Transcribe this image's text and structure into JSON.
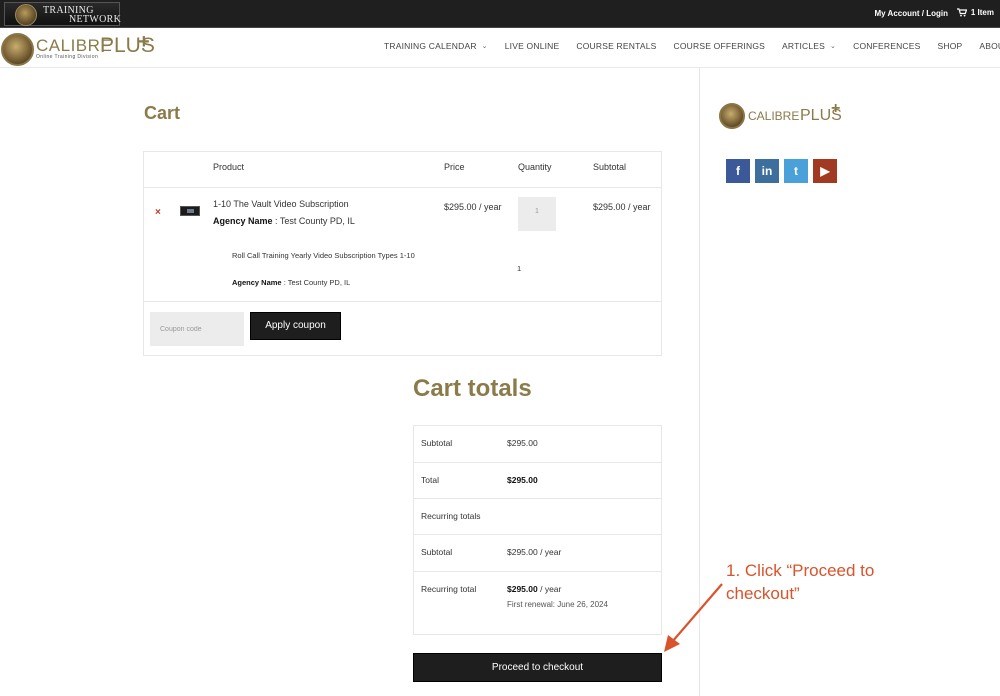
{
  "topbar": {
    "logo_line1": "TRAINING",
    "logo_line2": "NETWORK",
    "account_link": "My Account / Login",
    "cart_count": "1 Item"
  },
  "brand": {
    "word": "CALIBRE",
    "plus": "PLUS",
    "cross": "+",
    "sub": "Online Training Division"
  },
  "nav": [
    {
      "label": "TRAINING CALENDAR",
      "dropdown": true
    },
    {
      "label": "LIVE ONLINE",
      "dropdown": false
    },
    {
      "label": "COURSE RENTALS",
      "dropdown": false
    },
    {
      "label": "COURSE OFFERINGS",
      "dropdown": false
    },
    {
      "label": "ARTICLES",
      "dropdown": true
    },
    {
      "label": "CONFERENCES",
      "dropdown": false
    },
    {
      "label": "SHOP",
      "dropdown": false
    },
    {
      "label": "ABOUT US",
      "dropdown": true
    }
  ],
  "cart": {
    "title": "Cart",
    "headers": {
      "product": "Product",
      "price": "Price",
      "quantity": "Quantity",
      "subtotal": "Subtotal"
    },
    "item": {
      "remove_glyph": "×",
      "name": "1-10 The Vault Video Subscription",
      "agency_label": "Agency Name",
      "agency_value": " : Test County PD, IL",
      "price": "$295.00 / year",
      "quantity": "1",
      "subtotal": "$295.00 / year"
    },
    "sub_item": {
      "name": "Roll Call Training Yearly Video Subscription Types 1-10",
      "agency_label": "Agency Name",
      "agency_value": " : Test County PD, IL",
      "quantity": "1"
    },
    "coupon_placeholder": "Coupon code",
    "apply_label": "Apply coupon"
  },
  "totals": {
    "title": "Cart totals",
    "subtotal_label": "Subtotal",
    "subtotal_value": "$295.00",
    "total_label": "Total",
    "total_value": "$295.00",
    "recurring_label": "Recurring totals",
    "rec_subtotal_label": "Subtotal",
    "rec_subtotal_value": "$295.00 / year",
    "rec_total_label": "Recurring total",
    "rec_total_amount": "$295.00",
    "rec_total_period": " / year",
    "first_renewal": "First renewal: June 26, 2024",
    "checkout_label": "Proceed to checkout"
  },
  "annotation": {
    "text_line1": "1. Click “Proceed to",
    "text_line2": "checkout”",
    "color": "#d9532b"
  },
  "sidebar": {
    "logo_word": "CALIBRE",
    "logo_plus": "PLUS",
    "logo_cross": "+",
    "social": [
      {
        "name": "facebook-icon",
        "glyph": "f",
        "color": "#3b5998"
      },
      {
        "name": "linkedin-icon",
        "glyph": "in",
        "color": "#3c6e9e"
      },
      {
        "name": "twitter-icon",
        "glyph": "t",
        "color": "#4aa0d8"
      },
      {
        "name": "youtube-icon",
        "glyph": "▶",
        "color": "#a23a23"
      }
    ]
  },
  "colors": {
    "accent_gold": "#8b7a4a",
    "dark": "#1e1e1e",
    "remove_red": "#c0392b"
  }
}
